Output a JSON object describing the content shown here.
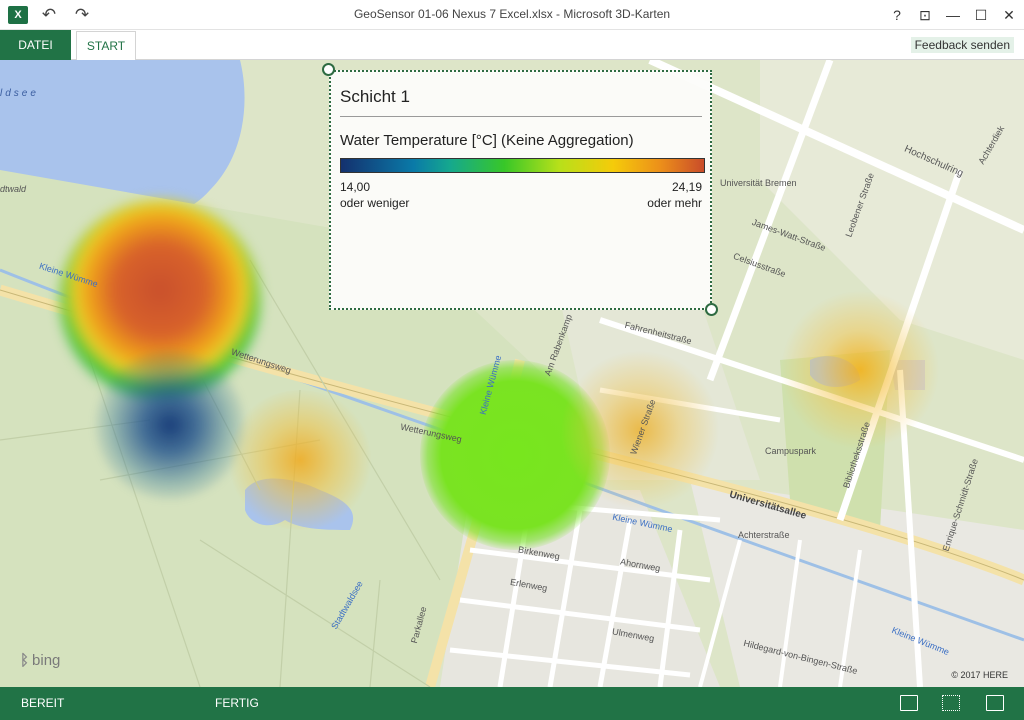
{
  "window": {
    "title": "GeoSensor 01-06 Nexus 7 Excel.xlsx - Microsoft 3D-Karten",
    "app_icon_letter": "X",
    "controls": {
      "help": "?",
      "ribbon_display": "⊡",
      "minimize": "—",
      "maximize": "☐",
      "close": "✕"
    }
  },
  "quick_access": {
    "undo": "↶",
    "redo": "↷"
  },
  "ribbon": {
    "tabs": [
      {
        "label": "DATEI"
      },
      {
        "label": "START"
      }
    ],
    "feedback_label": "Feedback senden"
  },
  "legend": {
    "layer_title": "Schicht 1",
    "field_label": "Water Temperature [°C] (Keine Aggregation)",
    "min_value": "14,00",
    "min_caption": "oder weniger",
    "max_value": "24,19",
    "max_caption": "oder mehr"
  },
  "map": {
    "provider": "bing",
    "copyright": "© 2017 HERE",
    "labels": [
      "ldsee",
      "dtwald",
      "Kleine Wümme",
      "Hochschulring",
      "Universität Bremen",
      "Universitätsallee",
      "Campuspark",
      "Achterstraße",
      "Kleine Wümme",
      "Parkallee",
      "Wetterungsweg",
      "Kleine Wümme",
      "James-Watt-Straße",
      "Fahrenheitstraße",
      "Celsiusstraße",
      "Am Rabenkamp",
      "Wiener Straße",
      "Wetterungsweg",
      "Hildegard-von-Bingen-Straße",
      "Birkenweg",
      "Erlenweg",
      "Ahornweg",
      "Ulmenweg",
      "Kleine Wümme",
      "Leobener Straße",
      "Bibliotheksstraße",
      "Enrique-Schmidt-Straße",
      "Achterdiek",
      "Stadtwaldsee"
    ]
  },
  "status": {
    "ready": "BEREIT",
    "done": "FERTIG"
  },
  "colors": {
    "accent": "#217346",
    "legend_border": "#2e6b42"
  }
}
